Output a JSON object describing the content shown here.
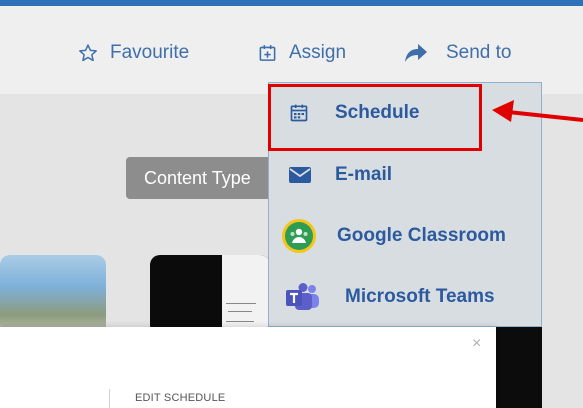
{
  "toolbar": {
    "favourite": {
      "label": "Favourite",
      "icon": "star-outline-icon"
    },
    "assign": {
      "label": "Assign",
      "icon": "calendar-plus-icon"
    },
    "send_to": {
      "label": "Send to",
      "icon": "share-arrow-icon"
    }
  },
  "content_type": {
    "label": "Content Type"
  },
  "send_menu": {
    "items": [
      {
        "label": "Schedule",
        "icon": "calendar-icon"
      },
      {
        "label": "E-mail",
        "icon": "envelope-icon"
      },
      {
        "label": "Google Classroom",
        "icon": "google-classroom-icon"
      },
      {
        "label": "Microsoft Teams",
        "icon": "microsoft-teams-icon"
      }
    ],
    "highlighted_item": "Schedule",
    "highlight_color": "#e00000"
  },
  "modal": {
    "title": "EDIT SCHEDULE",
    "close_glyph": "×"
  },
  "colors": {
    "accent": "#2f72b8",
    "link_text": "#3f6fa8",
    "menu_text": "#2c5a9f"
  }
}
